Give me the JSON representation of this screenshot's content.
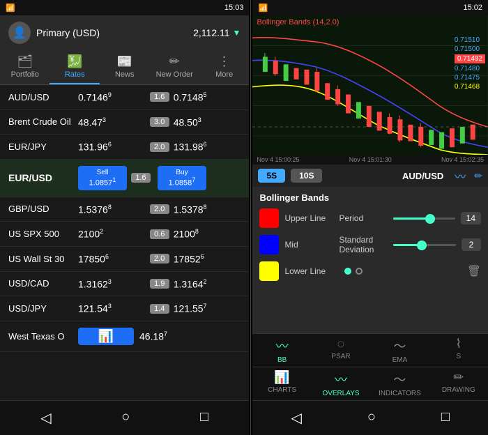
{
  "left": {
    "status": {
      "time": "15:03",
      "icons": "📶🔋"
    },
    "header": {
      "account": "Primary (USD)",
      "balance": "2,112.11",
      "arrow": "▼"
    },
    "nav": [
      {
        "id": "portfolio",
        "label": "Portfolio",
        "icon": "🗂"
      },
      {
        "id": "rates",
        "label": "Rates",
        "icon": "💹",
        "active": true
      },
      {
        "id": "news",
        "label": "News",
        "icon": "📰"
      },
      {
        "id": "new-order",
        "label": "New Order",
        "icon": "✏"
      },
      {
        "id": "more",
        "label": "More",
        "icon": "⋮"
      }
    ],
    "rates": [
      {
        "name": "AUD/USD",
        "bid": "0.7146",
        "bid_sup": "9",
        "change": "1.6",
        "ask": "0.7148",
        "ask_sup": "5"
      },
      {
        "name": "Brent Crude Oil",
        "bid": "48.47",
        "bid_sup": "3",
        "change": "3.0",
        "ask": "48.50",
        "ask_sup": "3"
      },
      {
        "name": "EUR/JPY",
        "bid": "131.96",
        "bid_sup": "6",
        "change": "2.0",
        "ask": "131.98",
        "ask_sup": "6"
      },
      {
        "name": "EUR/USD",
        "bold": true,
        "sell_label": "Sell",
        "sell_val": "1.0857",
        "sell_sup": "1",
        "change": "1.6",
        "buy_label": "Buy",
        "buy_val": "1.0858",
        "buy_sup": "7"
      },
      {
        "name": "GBP/USD",
        "bid": "1.5376",
        "bid_sup": "8",
        "change": "2.0",
        "ask": "1.5378",
        "ask_sup": "8"
      },
      {
        "name": "US SPX 500",
        "bid": "2100",
        "bid_sup": "2",
        "change": "0.6",
        "ask": "2100",
        "ask_sup": "8"
      },
      {
        "name": "US Wall St 30",
        "bid": "17850",
        "bid_sup": "6",
        "change": "2.0",
        "ask": "17852",
        "ask_sup": "6"
      },
      {
        "name": "USD/CAD",
        "bid": "1.3162",
        "bid_sup": "3",
        "change": "1.9",
        "ask": "1.3164",
        "ask_sup": "2"
      },
      {
        "name": "USD/JPY",
        "bid": "121.54",
        "bid_sup": "3",
        "change": "1.4",
        "ask": "121.55",
        "ask_sup": "7"
      },
      {
        "name": "West Texas O",
        "sparkline": true,
        "ask": "46.18",
        "ask_sup": "7"
      }
    ],
    "bottom_nav": [
      "◁",
      "○",
      "□"
    ]
  },
  "right": {
    "status": {
      "time": "15:02",
      "icons": "📶🔋"
    },
    "chart": {
      "title": "Bollinger Bands (14,2.0)",
      "prices": [
        "0.71510",
        "0.71500",
        "0.71492",
        "0.71480",
        "0.71475",
        "0.71468"
      ],
      "active_price": "0.71492",
      "times": [
        "Nov 4  15:00:25",
        "Nov 4  15:01:30",
        "Nov 4  15:02:35"
      ]
    },
    "timeframes": [
      "5S",
      "10S"
    ],
    "active_tf": "5S",
    "pair": "AUD/USD",
    "bollinger": {
      "title": "Bollinger Bands",
      "period_label": "Period",
      "period_val": "14",
      "period_pct": 60,
      "std_label": "Standard Deviation",
      "std_val": "2",
      "std_pct": 45,
      "colors": {
        "upper": "#f00",
        "mid": "#00f",
        "lower": "#ff0"
      },
      "upper_label": "Upper Line",
      "mid_label": "Mid",
      "lower_label": "Lower Line"
    },
    "indicator_tabs": [
      {
        "id": "bb",
        "label": "BB",
        "icon": "〰",
        "active": true
      },
      {
        "id": "psar",
        "label": "PSAR",
        "icon": "◌"
      },
      {
        "id": "ema",
        "label": "EMA",
        "icon": "〜"
      },
      {
        "id": "s",
        "label": "S",
        "icon": "⌇"
      }
    ],
    "bottom_tabs": [
      {
        "id": "charts",
        "label": "CHARTS",
        "icon": "📊"
      },
      {
        "id": "overlays",
        "label": "OVERLAYS",
        "icon": "〰",
        "active": true
      },
      {
        "id": "indicators",
        "label": "INDICATORS",
        "icon": "〜"
      },
      {
        "id": "drawing",
        "label": "DRAWING",
        "icon": "✏"
      }
    ],
    "bottom_nav": [
      "◁",
      "○",
      "□"
    ]
  }
}
